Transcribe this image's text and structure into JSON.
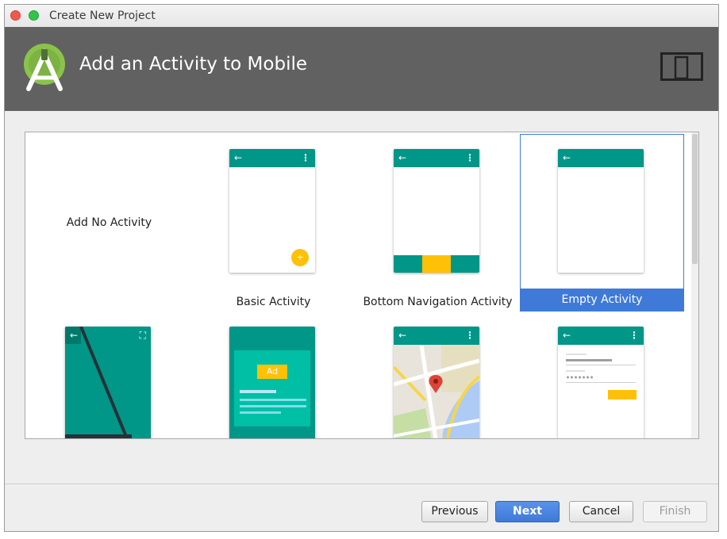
{
  "window": {
    "title": "Create New Project"
  },
  "header": {
    "title": "Add an Activity to Mobile"
  },
  "templates": [
    {
      "label": "Add No Activity"
    },
    {
      "label": "Basic Activity"
    },
    {
      "label": "Bottom Navigation Activity"
    },
    {
      "label": "Empty Activity",
      "selected": true
    },
    {
      "label": ""
    },
    {
      "label": "",
      "ad_text": "Ad"
    },
    {
      "label": ""
    },
    {
      "label": ""
    }
  ],
  "icons": {
    "back": "←",
    "more": "⋮",
    "fab": "+",
    "fullscreen": "⛶"
  },
  "buttons": {
    "previous": "Previous",
    "next": "Next",
    "cancel": "Cancel",
    "finish": "Finish"
  },
  "colors": {
    "header_bg": "#616161",
    "appbar": "#009688",
    "accent": "#ffc107",
    "selection": "#3f7ad9"
  }
}
